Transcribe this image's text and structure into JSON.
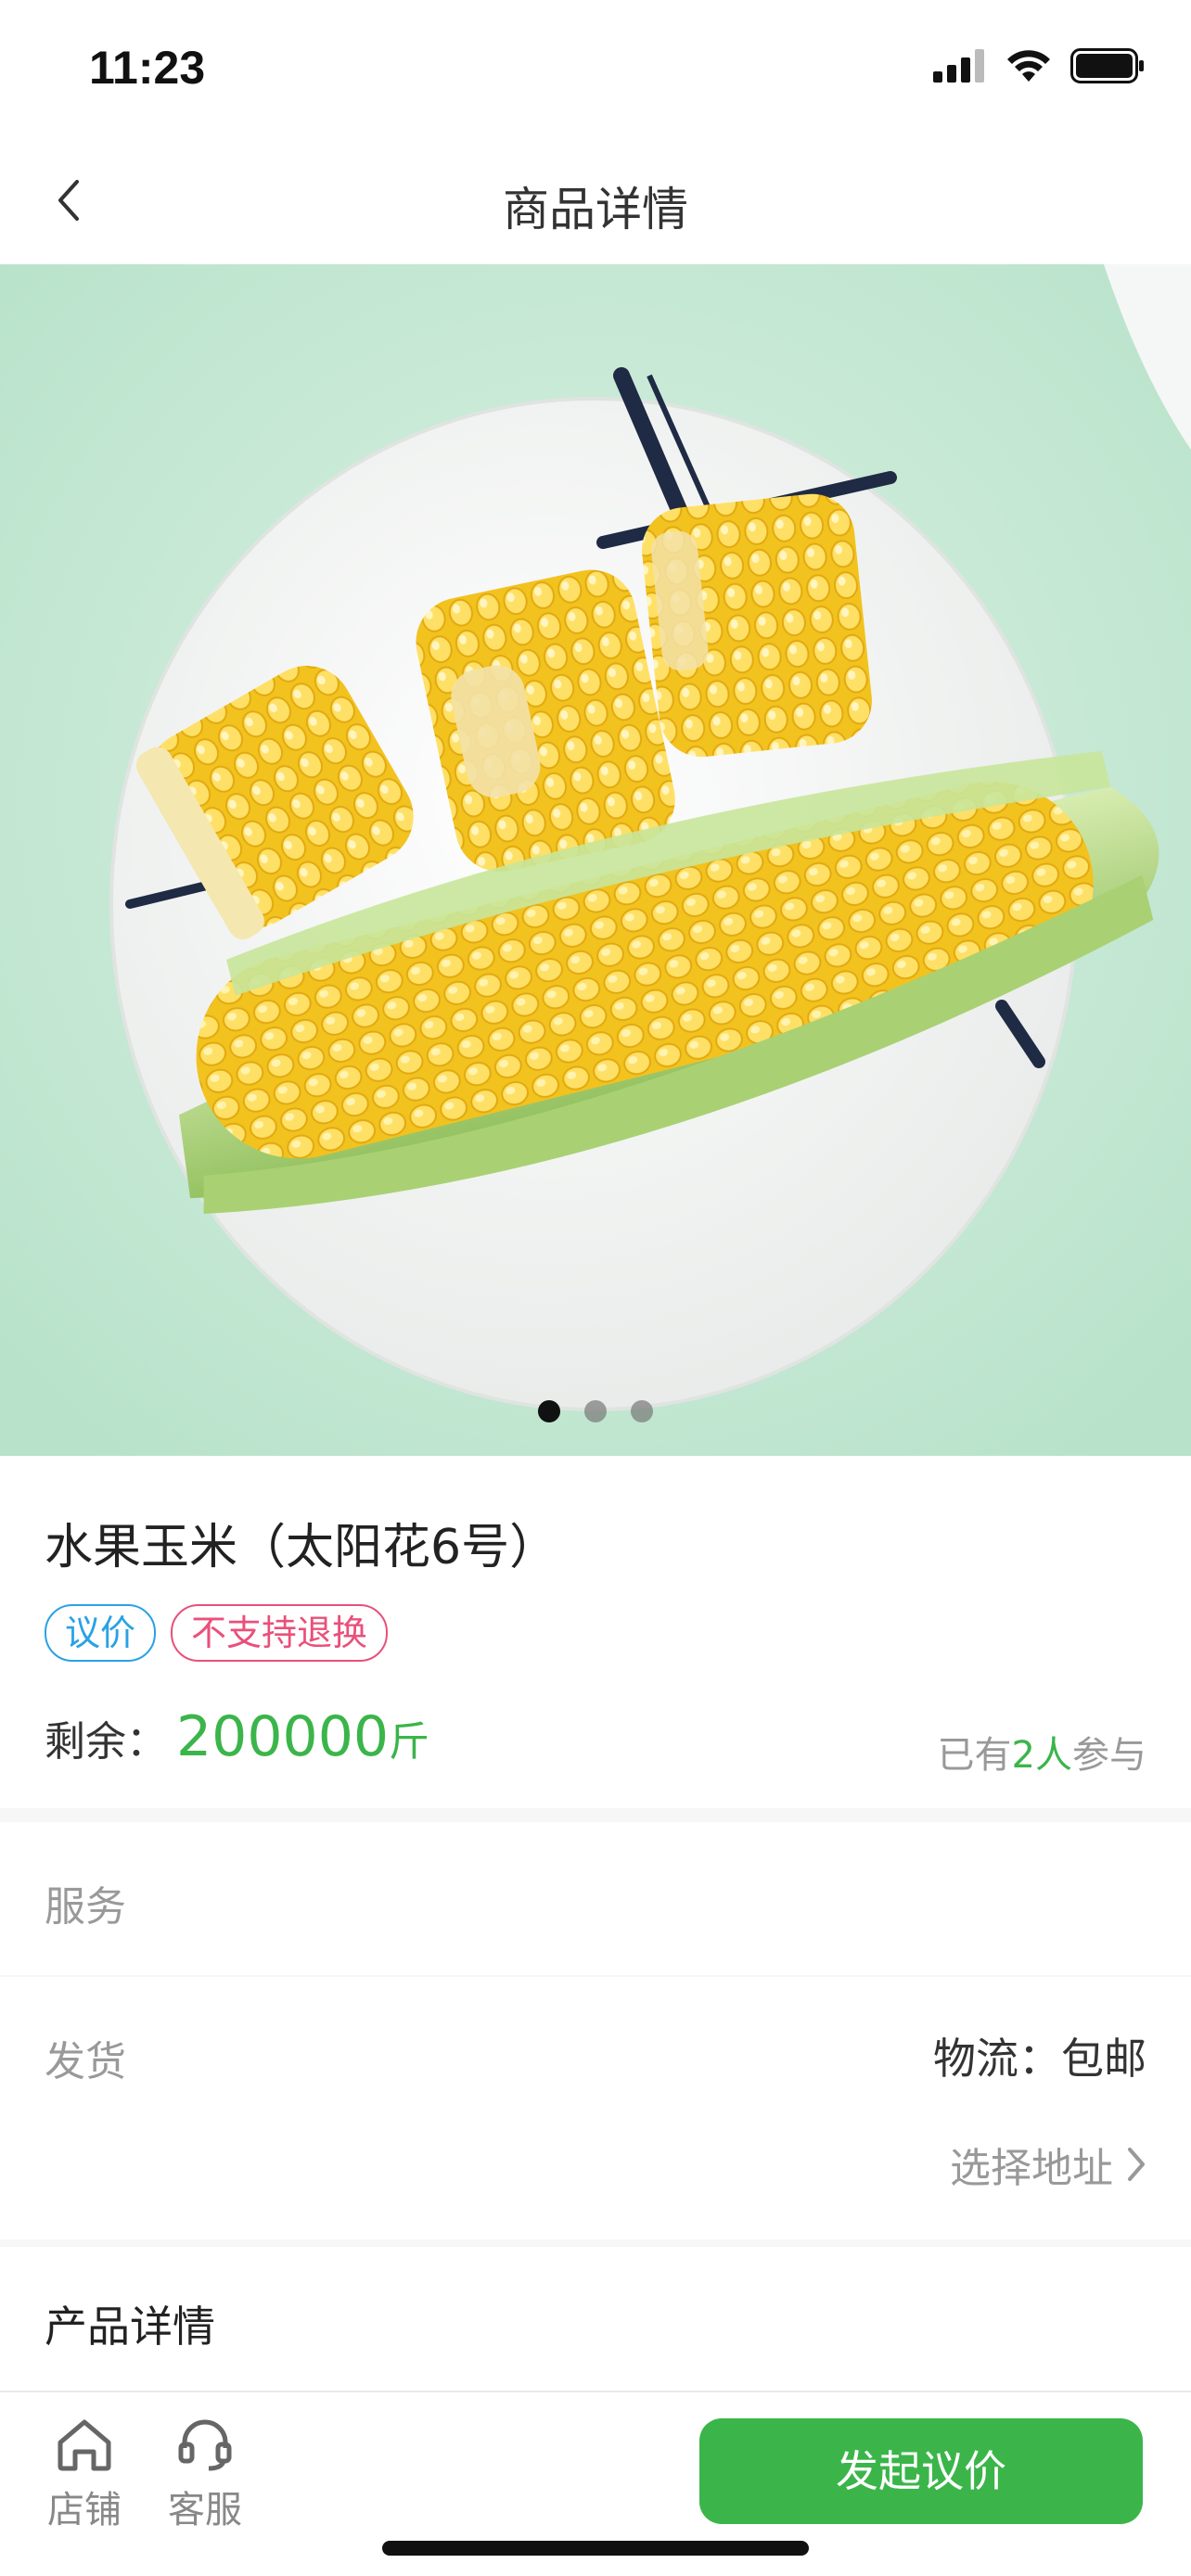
{
  "status_bar": {
    "time": "11:23"
  },
  "nav": {
    "title": "商品详情"
  },
  "carousel": {
    "total_slides": 3,
    "active_slide": 1
  },
  "product": {
    "name": "水果玉米（太阳花6号）",
    "tags": [
      "议价",
      "不支持退换"
    ],
    "remaining_label": "剩余：",
    "remaining_value": "200000",
    "remaining_unit": "斤",
    "participants_prefix": "已有",
    "participants_count": "2人",
    "participants_suffix": "参与"
  },
  "service": {
    "label": "服务"
  },
  "shipping": {
    "label": "发货",
    "logistics": "物流：包邮",
    "address_label": "选择地址"
  },
  "details": {
    "title": "产品详情"
  },
  "bottom_bar": {
    "shop_label": "店铺",
    "service_label": "客服",
    "cta_label": "发起议价"
  },
  "colors": {
    "accent": "#3bb54a",
    "tag_blue": "#2aa1e6",
    "tag_red": "#e9507a"
  },
  "icons": {
    "back": "chevron-left-icon",
    "address": "chevron-right-icon",
    "shop": "home-icon",
    "service": "headset-icon"
  }
}
